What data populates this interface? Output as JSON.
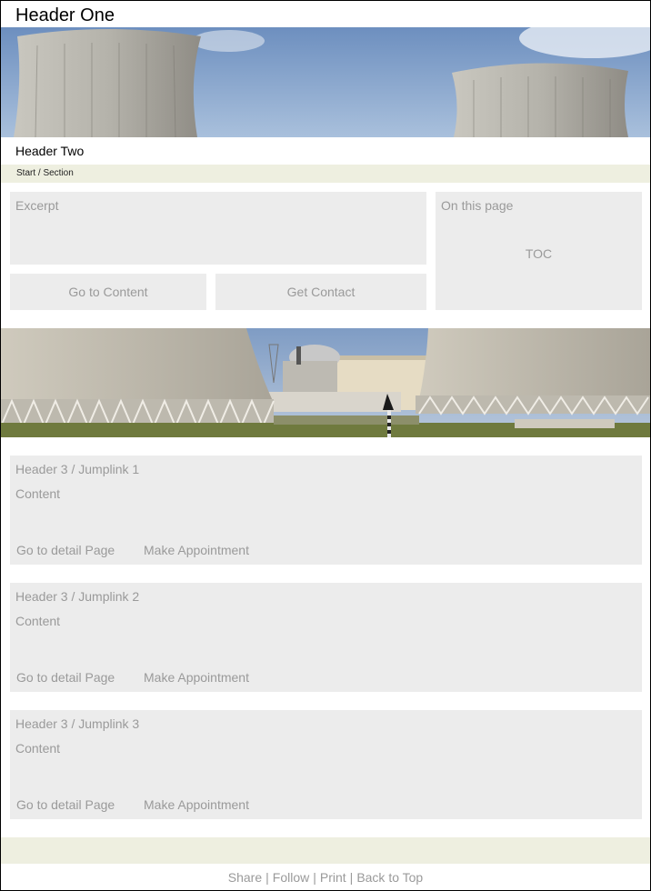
{
  "header": {
    "title_one": "Header One",
    "title_two": "Header Two"
  },
  "breadcrumb": "Start / Section",
  "intro": {
    "excerpt_label": "Excerpt",
    "go_to_content": "Go to Content",
    "get_contact": "Get Contact",
    "toc_heading": "On this page",
    "toc_label": "TOC"
  },
  "sections": [
    {
      "title": "Header 3 / Jumplink 1",
      "content": "Content",
      "detail": "Go to detail Page",
      "appointment": "Make Appointment"
    },
    {
      "title": "Header 3 / Jumplink 2",
      "content": "Content",
      "detail": "Go to detail Page",
      "appointment": "Make Appointment"
    },
    {
      "title": "Header 3 / Jumplink 3",
      "content": "Content",
      "detail": "Go to detail Page",
      "appointment": "Make Appointment"
    }
  ],
  "footer": {
    "share": "Share",
    "follow": "Follow",
    "print": "Print",
    "back_to_top": "Back to Top",
    "separator": "|"
  },
  "colors": {
    "panel": "#ececec",
    "band": "#eeefe0",
    "muted_text": "#9a9a9a"
  }
}
